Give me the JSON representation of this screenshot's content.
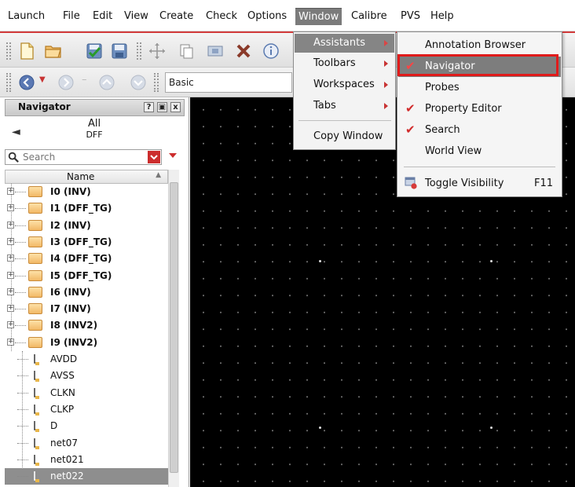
{
  "menubar": {
    "items": [
      "Launch",
      "File",
      "Edit",
      "View",
      "Create",
      "Check",
      "Options",
      "Window",
      "Calibre",
      "PVS",
      "Help"
    ]
  },
  "toolbar": {
    "view_combo_value": "Basic"
  },
  "navigator": {
    "title": "Navigator",
    "help_button": "?",
    "float_button": "▣",
    "close_button": "x",
    "back_arrow": "◄",
    "scope_title": "All",
    "scope_sub": "DFF",
    "search_placeholder": "Search",
    "column_header": "Name",
    "instances": [
      "I0 (INV)",
      "I1 (DFF_TG)",
      "I2 (INV)",
      "I3 (DFF_TG)",
      "I4 (DFF_TG)",
      "I5 (DFF_TG)",
      "I6 (INV)",
      "I7 (INV)",
      "I8 (INV2)",
      "I9 (INV2)"
    ],
    "nets": [
      "AVDD",
      "AVSS",
      "CLKN",
      "CLKP",
      "D",
      "net07",
      "net021",
      "net022"
    ],
    "selected": "net022"
  },
  "window_menu": {
    "items": [
      {
        "label": "Assistants",
        "submenu": true,
        "active": true
      },
      {
        "label": "Toolbars",
        "submenu": true
      },
      {
        "label": "Workspaces",
        "submenu": true
      },
      {
        "label": "Tabs",
        "submenu": true
      },
      {
        "label": "Copy Window",
        "submenu": false
      }
    ]
  },
  "assistants_menu": {
    "items": [
      {
        "label": "Annotation Browser",
        "checked": false
      },
      {
        "label": "Navigator",
        "checked": true,
        "highlighted": true
      },
      {
        "label": "Probes",
        "checked": false
      },
      {
        "label": "Property Editor",
        "checked": true
      },
      {
        "label": "Search",
        "checked": true
      },
      {
        "label": "World View",
        "checked": false
      }
    ],
    "toggle": {
      "label": "Toggle Visibility",
      "shortcut": "F11"
    }
  },
  "colors": {
    "accent_red": "#d12b2b",
    "highlight_box": "#e01b1b",
    "canvas_bg": "#000000",
    "menu_highlight": "#7d7d7d"
  }
}
